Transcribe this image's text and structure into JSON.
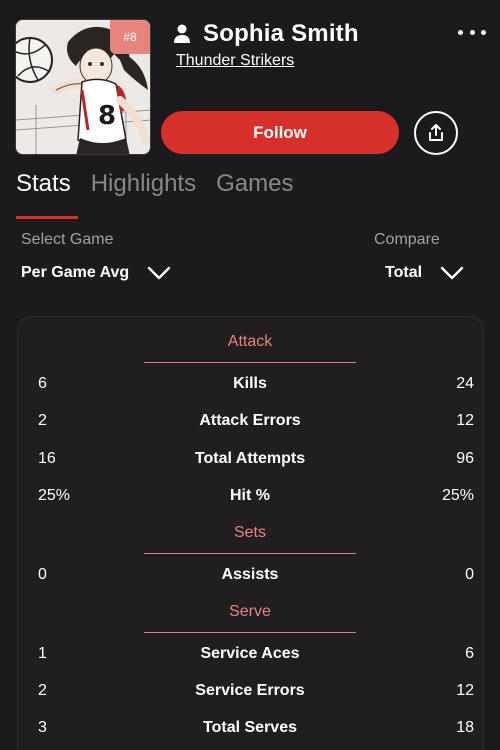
{
  "player": {
    "name": "Sophia Smith",
    "team": "Thunder Strikers",
    "jersey": "#8",
    "avatar_icon": "volleyball-player-illustration"
  },
  "actions": {
    "follow_label": "Follow",
    "share_icon": "share-icon",
    "more_icon": "more-dots-icon"
  },
  "tabs": [
    {
      "label": "Stats",
      "active": true
    },
    {
      "label": "Highlights",
      "active": false
    },
    {
      "label": "Games",
      "active": false
    }
  ],
  "filters": {
    "select_game_label": "Select Game",
    "select_game_value": "Per Game Avg",
    "compare_label": "Compare",
    "compare_value": "Total"
  },
  "sections": {
    "attack": {
      "title": "Attack",
      "rows": [
        {
          "left": "6",
          "label": "Kills",
          "right": "24"
        },
        {
          "left": "2",
          "label": "Attack Errors",
          "right": "12"
        },
        {
          "left": "16",
          "label": "Total Attempts",
          "right": "96"
        },
        {
          "left": "25%",
          "label": "Hit %",
          "right": "25%"
        }
      ]
    },
    "sets": {
      "title": "Sets",
      "rows": [
        {
          "left": "0",
          "label": "Assists",
          "right": "0"
        }
      ]
    },
    "serve": {
      "title": "Serve",
      "rows": [
        {
          "left": "1",
          "label": "Service Aces",
          "right": "6"
        },
        {
          "left": "2",
          "label": "Service Errors",
          "right": "12"
        },
        {
          "left": "3",
          "label": "Total Serves",
          "right": "18"
        }
      ]
    }
  },
  "colors": {
    "background": "#1c1a1d",
    "accent": "#d7302b",
    "section_title": "#e6857d",
    "muted": "#8a878c"
  }
}
